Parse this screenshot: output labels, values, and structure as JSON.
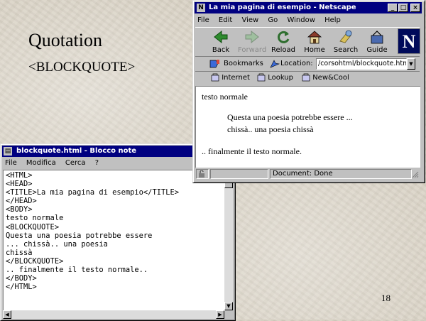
{
  "slide": {
    "title": "Quotation",
    "subtitle": "<BLOCKQUOTE>",
    "page_number": "18"
  },
  "netscape": {
    "title": "La mia pagina di esempio - Netscape",
    "menu": [
      "File",
      "Edit",
      "View",
      "Go",
      "Window",
      "Help"
    ],
    "toolbar": [
      {
        "label": "Back",
        "icon": "back-arrow-icon",
        "enabled": true
      },
      {
        "label": "Forward",
        "icon": "forward-arrow-icon",
        "enabled": false
      },
      {
        "label": "Reload",
        "icon": "reload-icon",
        "enabled": true
      },
      {
        "label": "Home",
        "icon": "home-icon",
        "enabled": true
      },
      {
        "label": "Search",
        "icon": "search-icon",
        "enabled": true
      },
      {
        "label": "Guide",
        "icon": "guide-icon",
        "enabled": true
      }
    ],
    "logo_letter": "N",
    "bookmarks_label": "Bookmarks",
    "location_label": "Location:",
    "location_value": "/corsohtml/blockquote.html",
    "directory_buttons": [
      "Internet",
      "Lookup",
      "New&Cool"
    ],
    "content": {
      "line1": "testo normale",
      "quote1": "Questa una poesia potrebbe essere ...",
      "quote2": "chissà.. una poesia chissà",
      "line2": ".. finalmente il testo normale."
    },
    "status": "Document: Done"
  },
  "notepad": {
    "title": "blockquote.html - Blocco note",
    "menu": [
      "File",
      "Modifica",
      "Cerca",
      "?"
    ],
    "text": "<HTML>\n<HEAD>\n<TITLE>La mia pagina di esempio</TITLE>\n</HEAD>\n<BODY>\ntesto normale\n<BLOCKQUOTE>\nQuesta una poesia potrebbe essere\n... chissà.. una poesia\nchissà\n</BLOCKQUOTE>\n.. finalmente il testo normale..\n</BODY>\n</HTML>"
  }
}
